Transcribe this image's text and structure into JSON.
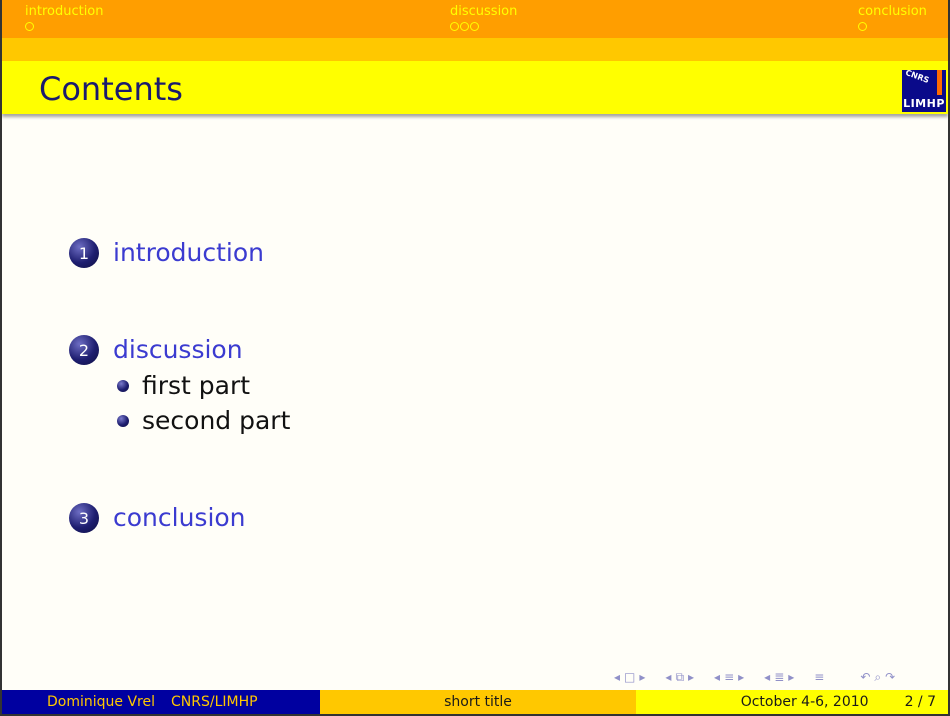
{
  "nav": {
    "sections": [
      {
        "label": "introduction",
        "dots": 1
      },
      {
        "label": "discussion",
        "dots": 3
      },
      {
        "label": "conclusion",
        "dots": 1
      }
    ]
  },
  "frame": {
    "title": "Contents",
    "logo": {
      "top": "CNRS",
      "bottom": "LIMHP"
    }
  },
  "toc": {
    "sections": [
      {
        "number": "1",
        "label": "introduction",
        "subsections": []
      },
      {
        "number": "2",
        "label": "discussion",
        "subsections": [
          "first part",
          "second part"
        ]
      },
      {
        "number": "3",
        "label": "conclusion",
        "subsections": []
      }
    ]
  },
  "footer": {
    "author": "Dominique Vrel",
    "institute": "CNRS/LIMHP",
    "short_title": "short title",
    "date": "October 4-6, 2010",
    "page": "2 / 7"
  },
  "colors": {
    "nav_band": "#ff9e00",
    "sub_band": "#ffc800",
    "title_band": "#ffff00",
    "title_text": "#1a1a6e",
    "section_link": "#3b3bd0",
    "footer_author_bg": "#0000a0"
  }
}
